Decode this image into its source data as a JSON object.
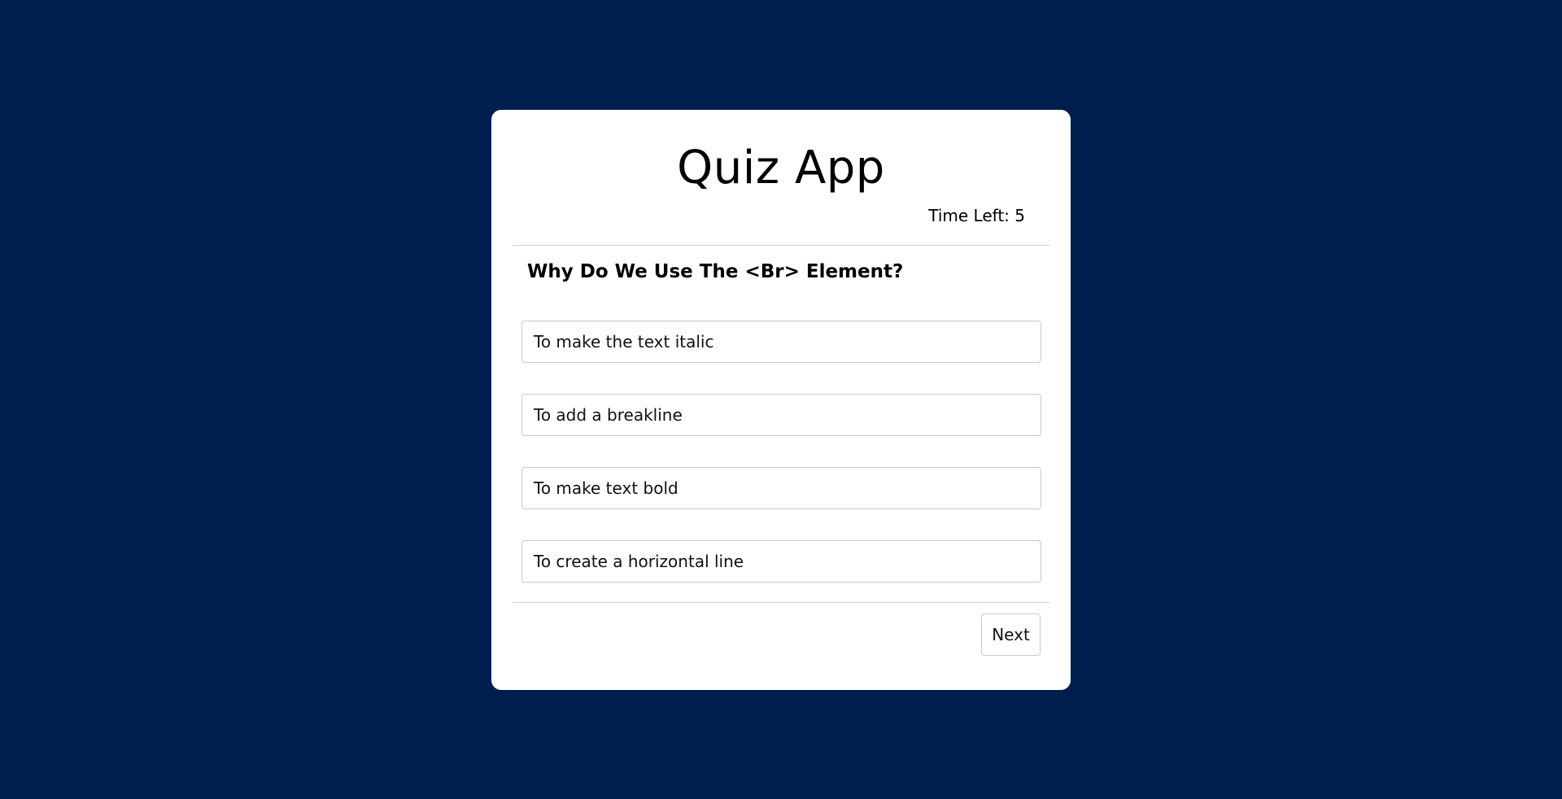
{
  "app": {
    "title": "Quiz App"
  },
  "timer": {
    "text": "Time Left: 5"
  },
  "question": {
    "text": "Why Do We Use The <Br> Element?"
  },
  "answers": [
    {
      "label": "To make the text italic"
    },
    {
      "label": "To add a breakline"
    },
    {
      "label": "To make text bold"
    },
    {
      "label": "To create a horizontal line"
    }
  ],
  "controls": {
    "next_label": "Next"
  },
  "colors": {
    "background": "#001e4d",
    "card": "#ffffff",
    "border": "#c9c9c9"
  }
}
